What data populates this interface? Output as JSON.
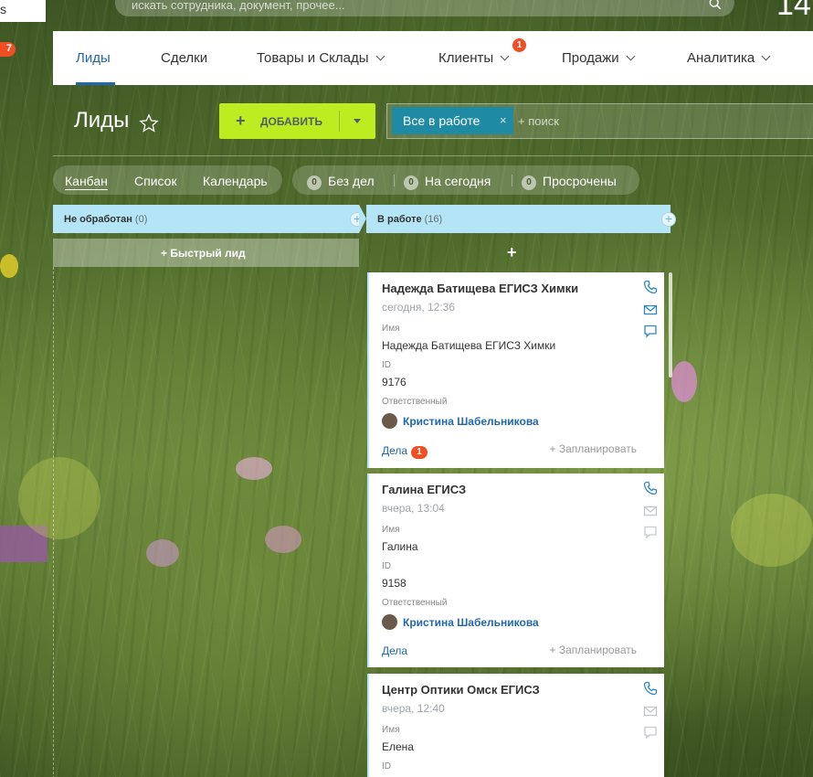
{
  "top": {
    "logo_text": "s",
    "search_placeholder": "искать сотрудника, документ, прочее...",
    "clock_text": "14",
    "left_badge": "7"
  },
  "nav": {
    "items": [
      {
        "label": "Лиды",
        "active": true
      },
      {
        "label": "Сделки"
      },
      {
        "label": "Товары и Склады"
      },
      {
        "label": "Клиенты",
        "badge": "1"
      },
      {
        "label": "Продажи"
      },
      {
        "label": "Аналитика"
      }
    ]
  },
  "page": {
    "title": "Лиды",
    "add_button": "ДОБАВИТЬ",
    "filter_chip": "Все в работе",
    "filter_remove": "×",
    "search_placeholder": "+ поиск"
  },
  "views": {
    "items": [
      "Канбан",
      "Список",
      "Календарь"
    ],
    "active": "Канбан"
  },
  "counters": [
    {
      "count": "0",
      "label": "Без дел"
    },
    {
      "count": "0",
      "label": "На сегодня"
    },
    {
      "count": "0",
      "label": "Просрочены"
    }
  ],
  "columns": [
    {
      "name": "Не обработан",
      "count": "(0)",
      "quick_lead": "Быстрый лид"
    },
    {
      "name": "В работе",
      "count": "(16)",
      "add": "+"
    }
  ],
  "cards": [
    {
      "title": "Надежда Батищева ЕГИСЗ Химки",
      "date": "сегодня, 12:36",
      "name_label": "Имя",
      "name_value": "Надежда Батищева ЕГИСЗ Химки",
      "id_label": "ID",
      "id_value": "9176",
      "owner_label": "Ответственный",
      "owner": "Кристина Шабельникова",
      "deals": "Дела",
      "deals_badge": "1",
      "plan": "+ Запланировать"
    },
    {
      "title": "Галина ЕГИСЗ",
      "date": "вчера, 13:04",
      "name_label": "Имя",
      "name_value": "Галина",
      "id_label": "ID",
      "id_value": "9158",
      "owner_label": "Ответственный",
      "owner": "Кристина Шабельникова",
      "deals": "Дела",
      "plan": "+ Запланировать"
    },
    {
      "title": "Центр Оптики Омск ЕГИСЗ",
      "date": "вчера, 12:40",
      "name_label": "Имя",
      "name_value": "Елена",
      "id_label": "ID"
    }
  ],
  "colors": {
    "accent_blue": "#2067b0",
    "add_green": "#bbed21",
    "column_head": "#b3e5f6",
    "badge_red": "#f04e23",
    "filter_chip": "#1f8aa3"
  }
}
